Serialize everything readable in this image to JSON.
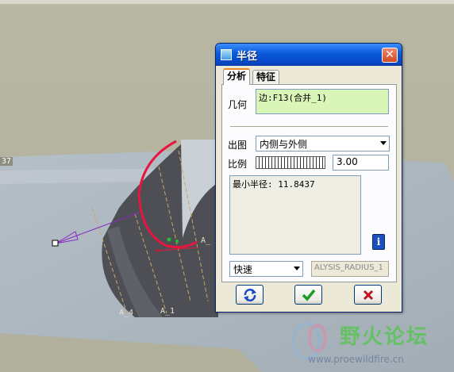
{
  "viewport": {
    "corner_label": "37",
    "axis_labels": [
      "A_4",
      "A_1",
      "A_"
    ]
  },
  "dialog": {
    "title": "半径",
    "close_label": "✕",
    "tabs": [
      {
        "label": "分析"
      },
      {
        "label": "特征"
      }
    ],
    "geometry_label": "几何",
    "geometry_value": "边:F13(合并_1)",
    "plot_label": "出图",
    "plot_value": "内侧与外侧",
    "scale_label": "比例",
    "scale_value": "3.00",
    "result_text": "最小半径: 11.8437",
    "info_label": "i",
    "mode_value": "快速",
    "analysis_name": "ALYSIS_RADIUS_1"
  },
  "watermark": {
    "title": "野火论坛",
    "url": "www.proewildfire.cn"
  },
  "colors": {
    "curve": "#e8163f",
    "title_bar": "#0a5ad8",
    "geometry_field": "#d9f5b8"
  }
}
